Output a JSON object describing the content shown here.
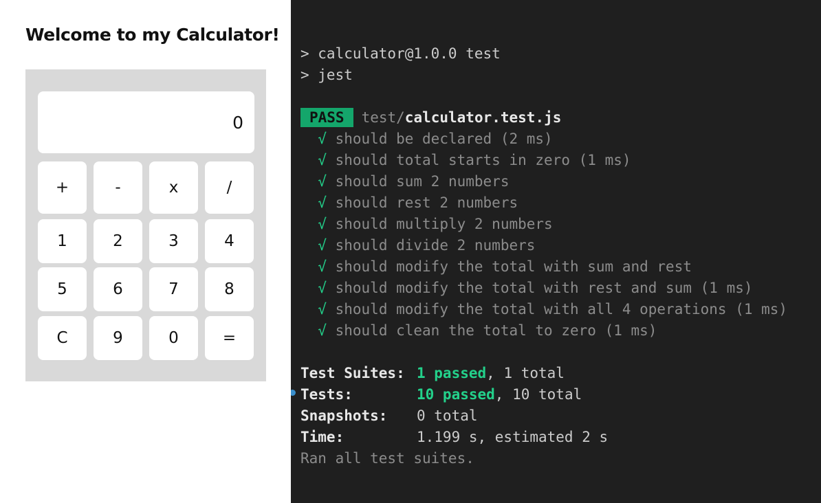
{
  "calculator": {
    "title": "Welcome to my Calculator!",
    "display_value": "0",
    "buttons": [
      [
        "+",
        "-",
        "x",
        "/"
      ],
      [
        "1",
        "2",
        "3",
        "4"
      ],
      [
        "5",
        "6",
        "7",
        "8"
      ],
      [
        "C",
        "9",
        "0",
        "="
      ]
    ]
  },
  "terminal": {
    "command_lines": [
      "> calculator@1.0.0 test",
      "> jest"
    ],
    "pass_badge": "PASS",
    "test_file_dir": "test/",
    "test_file_name": "calculator.test.js",
    "check_mark": "√",
    "tests": [
      {
        "name": "should be declared",
        "time": "(2 ms)"
      },
      {
        "name": "should total starts in zero",
        "time": "(1 ms)"
      },
      {
        "name": "should sum 2 numbers",
        "time": ""
      },
      {
        "name": "should rest 2 numbers",
        "time": ""
      },
      {
        "name": "should multiply 2 numbers",
        "time": ""
      },
      {
        "name": "should divide 2 numbers",
        "time": ""
      },
      {
        "name": "should modify the total with sum and rest",
        "time": ""
      },
      {
        "name": "should modify the total with rest and sum",
        "time": "(1 ms)"
      },
      {
        "name": "should modify the total with all 4 operations",
        "time": "(1 ms)"
      },
      {
        "name": "should clean the total to zero",
        "time": "(1 ms)"
      }
    ],
    "summary": {
      "suites_label": "Test Suites:",
      "suites_passed": "1 passed",
      "suites_total": ", 1 total",
      "tests_label": "Tests:",
      "tests_passed": "10 passed",
      "tests_total": ", 10 total",
      "snapshots_label": "Snapshots:",
      "snapshots_value": "0 total",
      "time_label": "Time:",
      "time_value": "1.199 s, estimated 2 s",
      "footer": "Ran all test suites."
    },
    "colors": {
      "background": "#1f1f1f",
      "pass_green": "#23d18b",
      "badge_green": "#14a66b"
    }
  }
}
